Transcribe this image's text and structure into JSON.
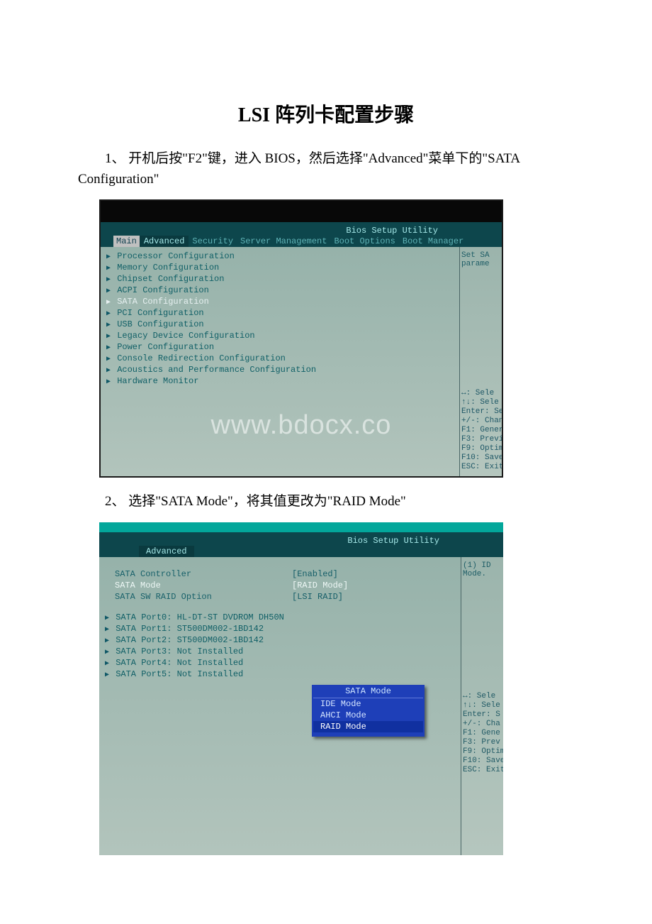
{
  "title": "LSI 阵列卡配置步骤",
  "step1_text": "1、 开机后按\"F2\"键，进入 BIOS，然后选择\"Advanced\"菜单下的\"SATA Configuration\"",
  "step2_text": "2、 选择\"SATA Mode\"，将其值更改为\"RAID Mode\"",
  "bios1": {
    "title": "Bios Setup Utility",
    "tabs": {
      "main": "Main",
      "advanced": "Advanced",
      "security": "Security",
      "server_mgmt": "Server Management",
      "boot_options": "Boot Options",
      "boot_manager": "Boot Manager"
    },
    "menu": {
      "processor": "Processor Configuration",
      "memory": "Memory Configuration",
      "chipset": "Chipset Configuration",
      "acpi": "ACPI Configuration",
      "sata": "SATA Configuration",
      "pci": "PCI Configuration",
      "usb": "USB Configuration",
      "legacy": "Legacy Device Configuration",
      "power": "Power Configuration",
      "console": "Console Redirection Configuration",
      "acoustics": "Acoustics and Performance Configuration",
      "hwmon": "Hardware Monitor"
    },
    "side_top": {
      "l1": "Set SA",
      "l2": "parame"
    },
    "help": {
      "h1": "↔: Sele",
      "h2": "↑↓: Sele",
      "h3": "Enter: Se",
      "h4": "+/-: Chan",
      "h5": "F1: Gener",
      "h6": "F3: Previ",
      "h7": "F9: Optim",
      "h8": "F10: Save",
      "h9": "ESC: Exit"
    },
    "watermark": "www.bdocx.co"
  },
  "bios2": {
    "title": "Bios Setup Utility",
    "tab_advanced": "Advanced",
    "rows": {
      "ctrl_label": "SATA Controller",
      "ctrl_value": "[Enabled]",
      "mode_label": "SATA Mode",
      "mode_value": "[RAID Mode]",
      "sw_label": "SATA SW RAID Option",
      "sw_value": "[LSI RAID]",
      "p0": "SATA Port0: HL-DT-ST DVDROM DH50N",
      "p1": "SATA Port1: ST500DM002-1BD142",
      "p2": "SATA Port2: ST500DM002-1BD142",
      "p3": "SATA Port3: Not Installed",
      "p4": "SATA Port4: Not Installed",
      "p5": "SATA Port5: Not Installed"
    },
    "popup": {
      "title": "SATA Mode",
      "ide": "IDE Mode",
      "ahci": "AHCI Mode",
      "raid": "RAID Mode"
    },
    "side_top": {
      "l1": "(1) ID",
      "l2": "Mode."
    },
    "help": {
      "h1": "↔: Sele",
      "h2": "↑↓: Sele",
      "h3": "Enter: S",
      "h4": "+/-: Cha",
      "h5": "F1: Gene",
      "h6": "F3: Prev",
      "h7": "F9: Optim",
      "h8": "F10: Save",
      "h9": "ESC: Exit"
    }
  }
}
